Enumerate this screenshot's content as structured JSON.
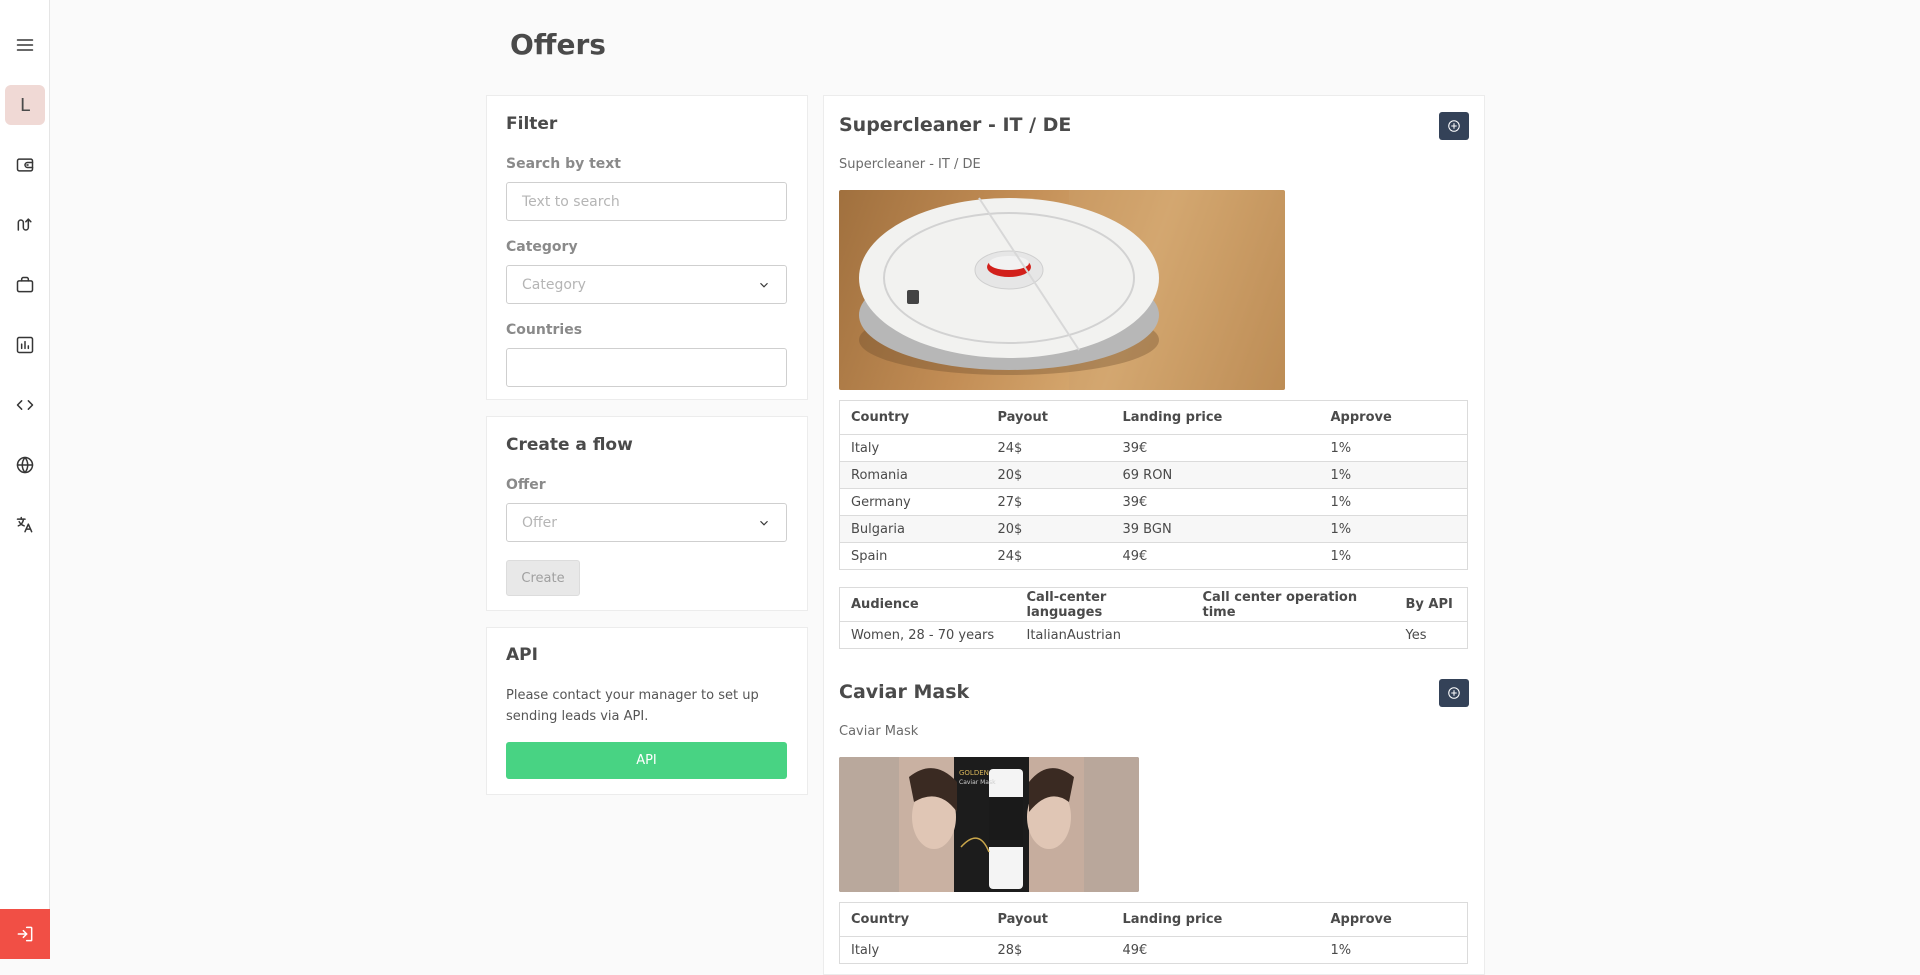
{
  "page": {
    "title": "Offers"
  },
  "sidebar": {
    "avatar_letter": "L",
    "items": [
      {
        "name": "menu-icon"
      },
      {
        "name": "wallet-icon"
      },
      {
        "name": "flows-icon"
      },
      {
        "name": "briefcase-icon"
      },
      {
        "name": "stats-icon"
      },
      {
        "name": "code-icon"
      },
      {
        "name": "globe-icon"
      },
      {
        "name": "translate-icon"
      }
    ],
    "logout_icon": "logout-icon"
  },
  "filter": {
    "title": "Filter",
    "search_label": "Search by text",
    "search_placeholder": "Text to search",
    "category_label": "Category",
    "category_placeholder": "Category",
    "countries_label": "Countries",
    "countries_value": ""
  },
  "flow": {
    "title": "Create a flow",
    "offer_label": "Offer",
    "offer_placeholder": "Offer",
    "create_label": "Create"
  },
  "api": {
    "title": "API",
    "text": "Please contact your manager to set up sending leads via API.",
    "button_label": "API"
  },
  "offers": [
    {
      "title": "Supercleaner - IT / DE",
      "subtitle": "Supercleaner - IT / DE",
      "headers": [
        "Country",
        "Payout",
        "Landing price",
        "Approve"
      ],
      "rows": [
        [
          "Italy",
          "24$",
          "39€",
          "1%"
        ],
        [
          "Romania",
          "20$",
          "69 RON",
          "1%"
        ],
        [
          "Germany",
          "27$",
          "39€",
          "1%"
        ],
        [
          "Bulgaria",
          "20$",
          "39 BGN",
          "1%"
        ],
        [
          "Spain",
          "24$",
          "49€",
          "1%"
        ]
      ],
      "info_headers": [
        "Audience",
        "Call-center languages",
        "Call center operation time",
        "By API"
      ],
      "info_row": [
        "Women, 28 - 70 years",
        "ItalianAustrian",
        "",
        "Yes"
      ]
    },
    {
      "title": "Caviar Mask",
      "subtitle": "Caviar Mask",
      "image_text_1": "GOLDEN",
      "image_text_2": "Caviar Mask",
      "headers": [
        "Country",
        "Payout",
        "Landing price",
        "Approve"
      ],
      "rows": [
        [
          "Italy",
          "28$",
          "49€",
          "1%"
        ]
      ]
    }
  ]
}
